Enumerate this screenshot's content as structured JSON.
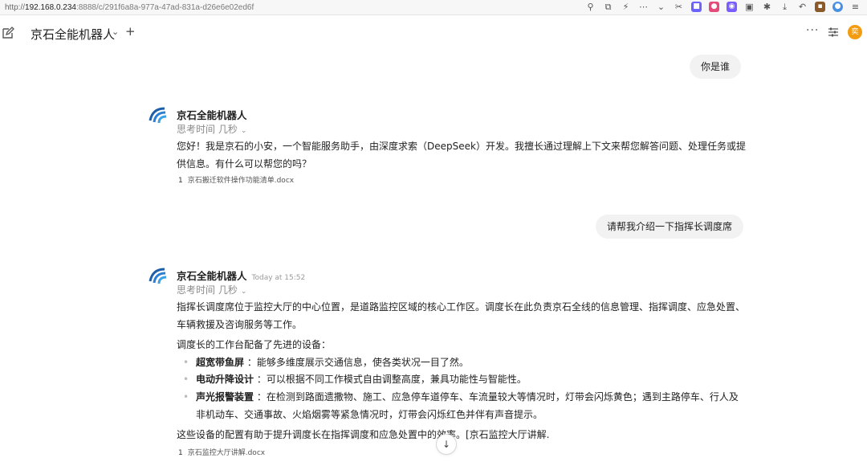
{
  "browser": {
    "url_prefix": "http://",
    "url_host": "192.168.0.234",
    "url_rest": ":8888/c/291f6a8a-977a-47ad-831a-d26e6e02ed6f"
  },
  "header": {
    "model_name": "京石全能机器人",
    "more_label": "···"
  },
  "user_avatar_initial": "奕",
  "messages": {
    "q1": "你是谁",
    "a1": {
      "name": "京石全能机器人",
      "thinking": "思考时间 几秒",
      "text": "您好！我是京石的小安，一个智能服务助手，由深度求索（DeepSeek）开发。我擅长通过理解上下文来帮您解答问题、处理任务或提供信息。有什么可以帮您的吗？",
      "source_index": "1",
      "source_name": "京石搬迁软件操作功能清单.docx"
    },
    "q2": "请帮我介绍一下指挥长调度席",
    "a2": {
      "name": "京石全能机器人",
      "time": "Today at 15:52",
      "thinking": "思考时间 几秒",
      "intro": "指挥长调度席位于监控大厅的中心位置，是道路监控区域的核心工作区。调度长在此负责京石全线的信息管理、指挥调度、应急处置、车辆救援及咨询服务等工作。",
      "lead": "调度长的工作台配备了先进的设备：",
      "bullets": [
        {
          "term": "超宽带鱼屏",
          "desc": "：能够多维度展示交通信息，使各类状况一目了然。"
        },
        {
          "term": "电动升降设计",
          "desc": "：可以根据不同工作模式自由调整高度，兼具功能性与智能性。"
        },
        {
          "term": "声光报警装置",
          "desc": "：在检测到路面遗撒物、施工、应急停车道停车、车流量较大等情况时，灯带会闪烁黄色；遇到主路停车、行人及非机动车、交通事故、火焰烟雾等紧急情况时，灯带会闪烁红色并伴有声音提示。"
        }
      ],
      "closing": "这些设备的配置有助于提升调度长在指挥调度和应急处置中的效率。[京石监控大厅讲解.",
      "source_index": "1",
      "source_name": "京石监控大厅讲解.docx"
    }
  }
}
